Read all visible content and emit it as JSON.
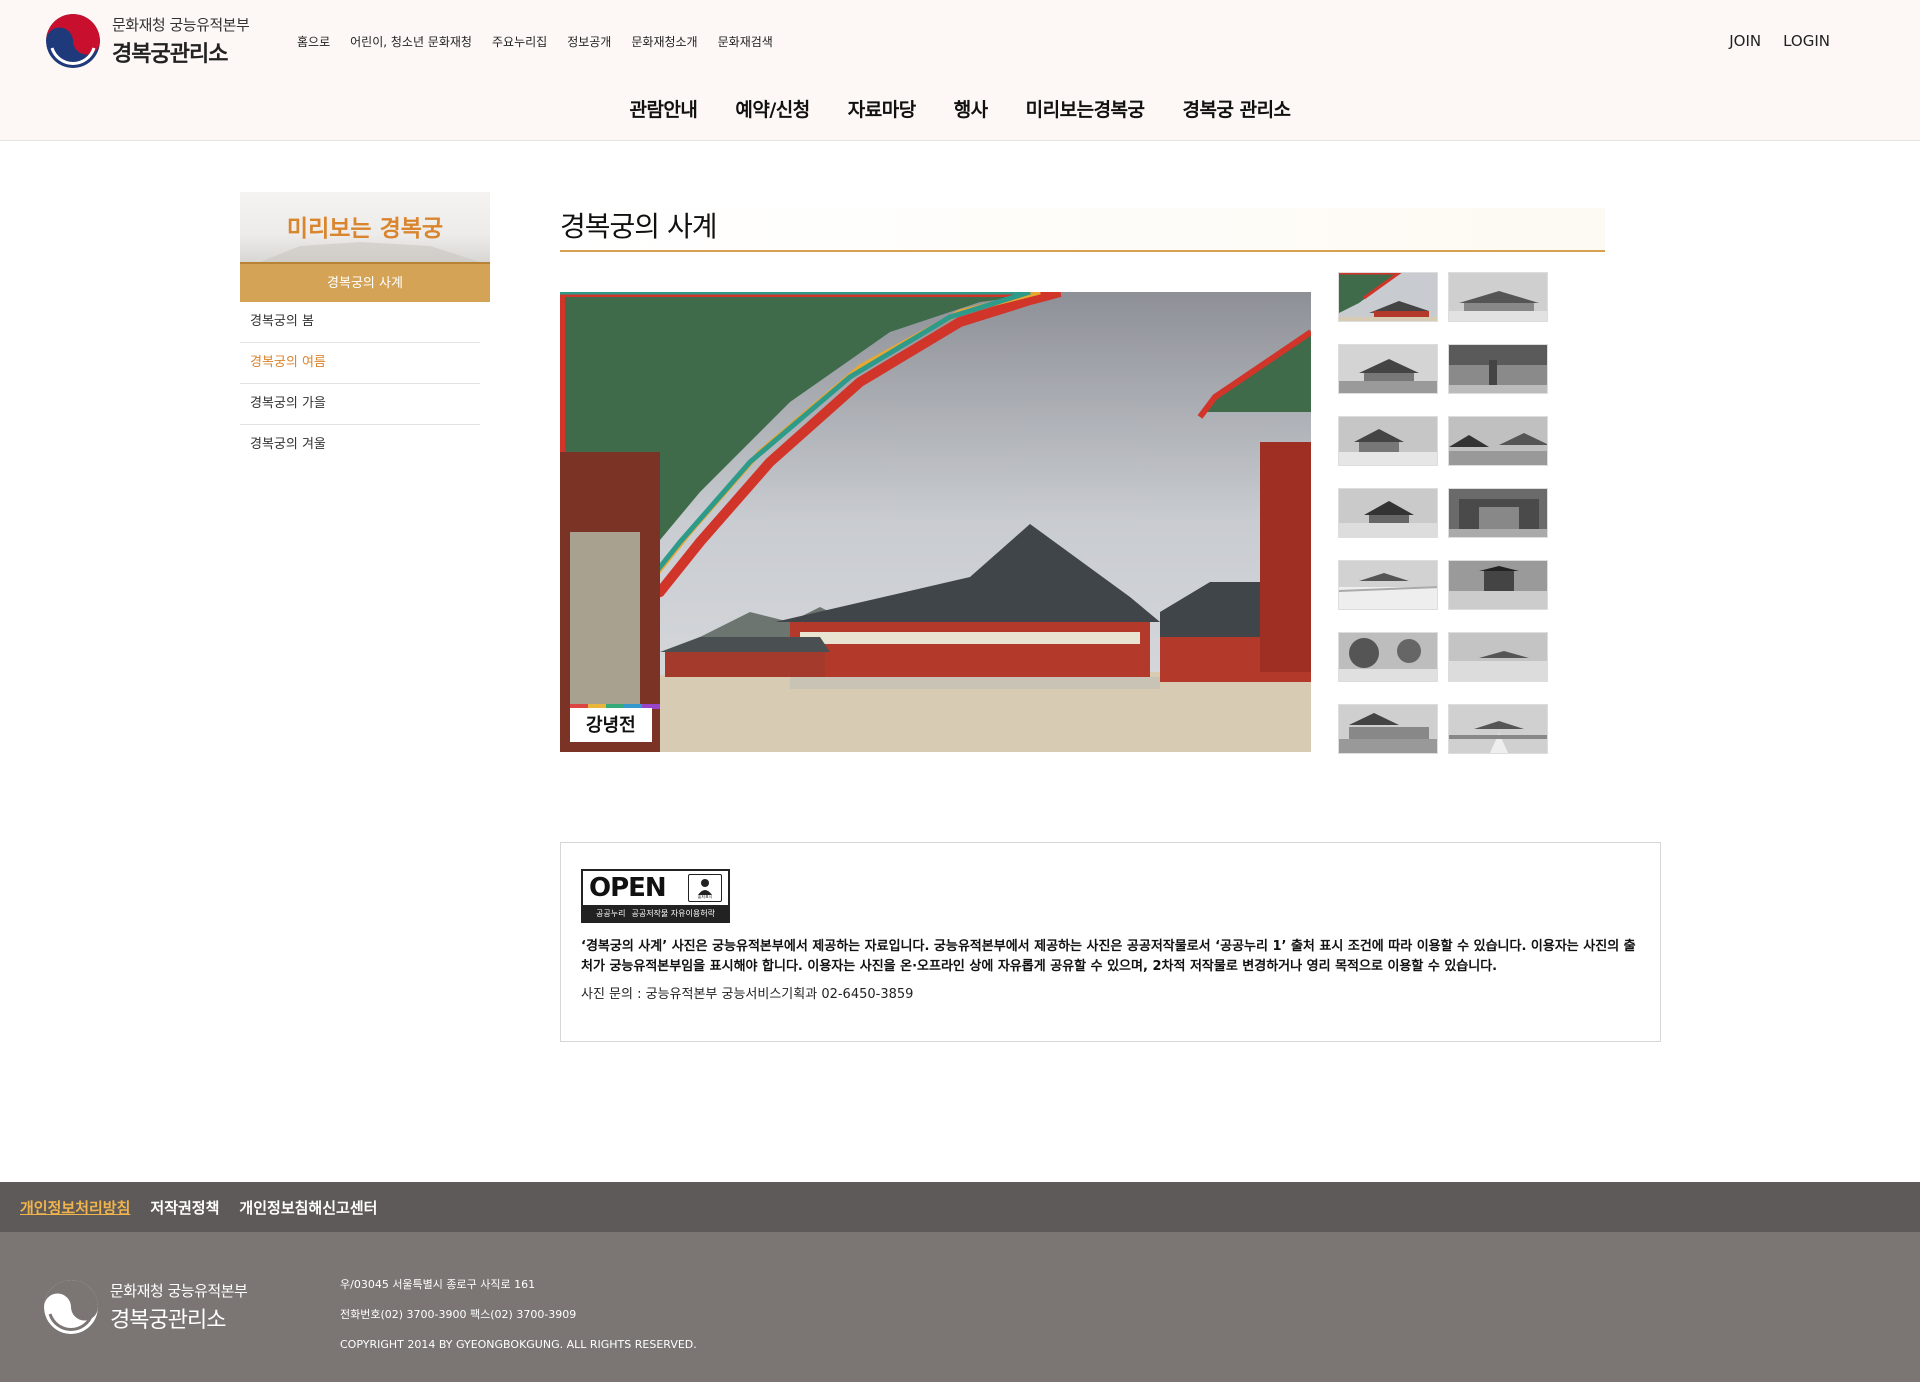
{
  "header": {
    "org_line1": "문화재청 궁능유적본부",
    "org_line2": "경복궁관리소",
    "util_nav": [
      "홈으로",
      "어린이, 청소년 문화재청",
      "주요누리집",
      "정보공개",
      "문화재청소개",
      "문화재검색"
    ],
    "join": "JOIN",
    "login": "LOGIN",
    "gnb": [
      "관람안내",
      "예약/신청",
      "자료마당",
      "행사",
      "미리보는경복궁",
      "경복궁 관리소"
    ]
  },
  "sidebar": {
    "title": "미리보는 경복궁",
    "active": "경복궁의 사계",
    "items": [
      "경복궁의 봄",
      "경복궁의 여름",
      "경복궁의 가을",
      "경복궁의 겨울"
    ],
    "current_index": 1
  },
  "content": {
    "title": "경복궁의 사계",
    "photo_caption": "강녕전",
    "thumbnail_count": 14
  },
  "license": {
    "badge_word": "OPEN",
    "badge_bottom_left": "공공누리",
    "badge_bottom_right": "공공저작물 자유이용허락",
    "badge_person_label": "출처표시",
    "text": "‘경복궁의 사계’ 사진은 궁능유적본부에서 제공하는 자료입니다. 궁능유적본부에서 제공하는 사진은 공공저작물로서 ‘공공누리 1’ 출처 표시 조건에 따라 이용할 수 있습니다. 이용자는 사진의 출처가 궁능유적본부임을 표시해야 합니다. 이용자는 사진을 온·오프라인 상에 자유롭게 공유할 수 있으며, 2차적 저작물로 변경하거나 영리 목적으로 이용할 수 있습니다.",
    "contact": "사진 문의 : 궁능유적본부 궁능서비스기획과 02-6450-3859"
  },
  "footer": {
    "links": [
      "개인정보처리방침",
      "저작권정책",
      "개인정보침해신고센터"
    ],
    "org_line1": "문화재청 궁능유적본부",
    "org_line2": "경복궁관리소",
    "address": "우/03045 서울특별시 종로구 사직로 161",
    "phone": "전화번호(02) 3700-3900 팩스(02) 3700-3909",
    "copyright": "COPYRIGHT 2014 BY GYEONGBOKGUNG. ALL RIGHTS RESERVED."
  },
  "colors": {
    "accent_gold": "#d4a356",
    "accent_orange": "#d9852e",
    "footer_dark": "#5d5a59",
    "footer_main": "#7b7574",
    "logo_red": "#c8102e",
    "logo_blue": "#1f3a7a"
  }
}
